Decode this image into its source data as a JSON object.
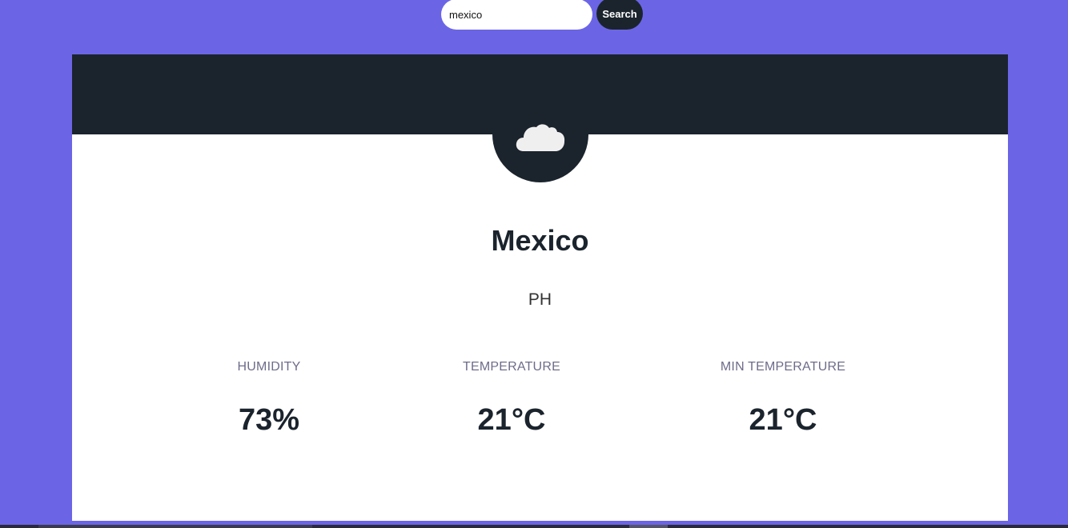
{
  "search": {
    "value": "mexico",
    "button_label": "Search"
  },
  "weather": {
    "icon": "cloud-icon",
    "city": "Mexico",
    "country": "PH",
    "stats": {
      "humidity_label": "HUMIDITY",
      "humidity_value": "73%",
      "temperature_label": "TEMPERATURE",
      "temperature_value": "21°C",
      "min_temperature_label": "MIN TEMPERATURE",
      "min_temperature_value": "21°C"
    }
  },
  "colors": {
    "background": "#6b65e6",
    "dark": "#1b242d",
    "card": "#ffffff",
    "label": "#6e6c8a"
  }
}
